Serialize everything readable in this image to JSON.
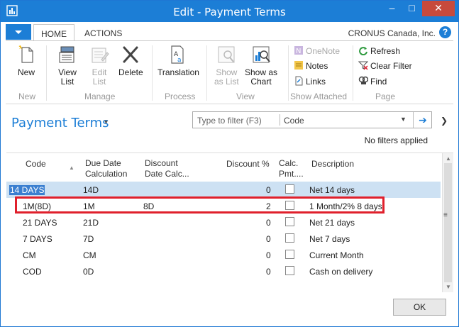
{
  "window": {
    "title": "Edit - Payment Terms",
    "minimize": "–",
    "maximize": "□",
    "close": "✕"
  },
  "ribbon_tabs": {
    "home": "HOME",
    "actions": "ACTIONS",
    "company": "CRONUS Canada, Inc.",
    "help": "?"
  },
  "ribbon": {
    "new": {
      "label": "New",
      "group": "New"
    },
    "manage": {
      "view_list": [
        "View",
        "List"
      ],
      "edit_list": [
        "Edit",
        "List"
      ],
      "delete": "Delete",
      "group": "Manage"
    },
    "process": {
      "translation": "Translation",
      "group": "Process"
    },
    "view": {
      "show_as_list": [
        "Show",
        "as List"
      ],
      "show_as_chart": [
        "Show as",
        "Chart"
      ],
      "group": "View"
    },
    "show_attached": {
      "onenote": "OneNote",
      "notes": "Notes",
      "links": "Links",
      "group": "Show Attached"
    },
    "page": {
      "refresh": "Refresh",
      "clear_filter": "Clear Filter",
      "find": "Find",
      "group": "Page"
    }
  },
  "page": {
    "title": "Payment Terms",
    "title_caret": "▾",
    "filter_placeholder": "Type to filter (F3)",
    "filter_field": "Code",
    "no_filters": "No filters applied",
    "ok": "OK"
  },
  "columns": {
    "code": "Code",
    "due_date": [
      "Due Date",
      "Calculation"
    ],
    "discount_date": [
      "Discount",
      "Date Calc..."
    ],
    "discount_pct": "Discount %",
    "calc_pmt": [
      "Calc.",
      "Pmt...."
    ],
    "description": "Description"
  },
  "rows": [
    {
      "code": "14 DAYS",
      "due": "14D",
      "disc_date": "",
      "disc_pct": "0",
      "calc": false,
      "desc": "Net 14 days"
    },
    {
      "code": "1M(8D)",
      "due": "1M",
      "disc_date": "8D",
      "disc_pct": "2",
      "calc": false,
      "desc": "1 Month/2% 8 days"
    },
    {
      "code": "21 DAYS",
      "due": "21D",
      "disc_date": "",
      "disc_pct": "0",
      "calc": false,
      "desc": "Net 21 days"
    },
    {
      "code": "7 DAYS",
      "due": "7D",
      "disc_date": "",
      "disc_pct": "0",
      "calc": false,
      "desc": "Net 7 days"
    },
    {
      "code": "CM",
      "due": "CM",
      "disc_date": "",
      "disc_pct": "0",
      "calc": false,
      "desc": "Current Month"
    },
    {
      "code": "COD",
      "due": "0D",
      "disc_date": "",
      "disc_pct": "0",
      "calc": false,
      "desc": "Cash on delivery"
    }
  ],
  "colors": {
    "accent": "#1c7ed6",
    "selected_row": "#cde1f3",
    "highlight": "#e0202c"
  }
}
